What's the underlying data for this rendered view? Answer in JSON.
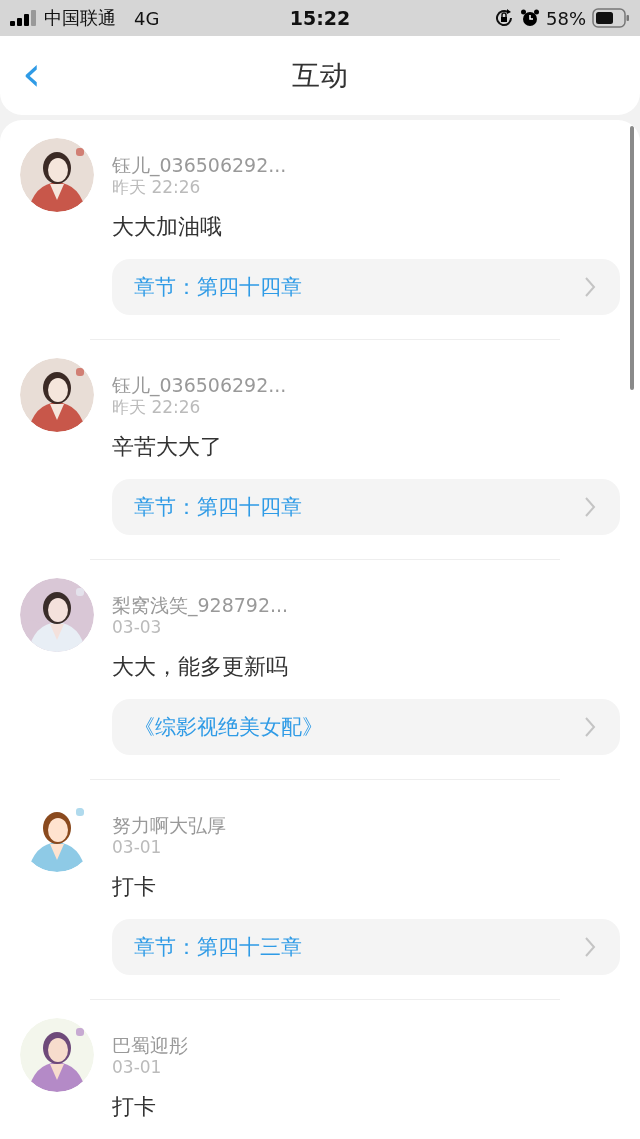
{
  "status_bar": {
    "carrier": "中国联通",
    "network": "4G",
    "time": "15:22",
    "battery": "58%"
  },
  "header": {
    "back": "‹",
    "title": "互动"
  },
  "comments": [
    {
      "user": "钰儿_036506292...",
      "time": "昨天 22:26",
      "text": "大大加油哦",
      "link": "章节：第四十四章"
    },
    {
      "user": "钰儿_036506292...",
      "time": "昨天 22:26",
      "text": "辛苦大大了",
      "link": "章节：第四十四章"
    },
    {
      "user": "梨窝浅笑_928792...",
      "time": "03-03",
      "text": "大大，能多更新吗",
      "link": "《综影视绝美女配》"
    },
    {
      "user": "努力啊大弘厚",
      "time": "03-01",
      "text": "打卡",
      "link": "章节：第四十三章"
    },
    {
      "user": "巴蜀迎彤",
      "time": "03-01",
      "text": "打卡"
    }
  ]
}
